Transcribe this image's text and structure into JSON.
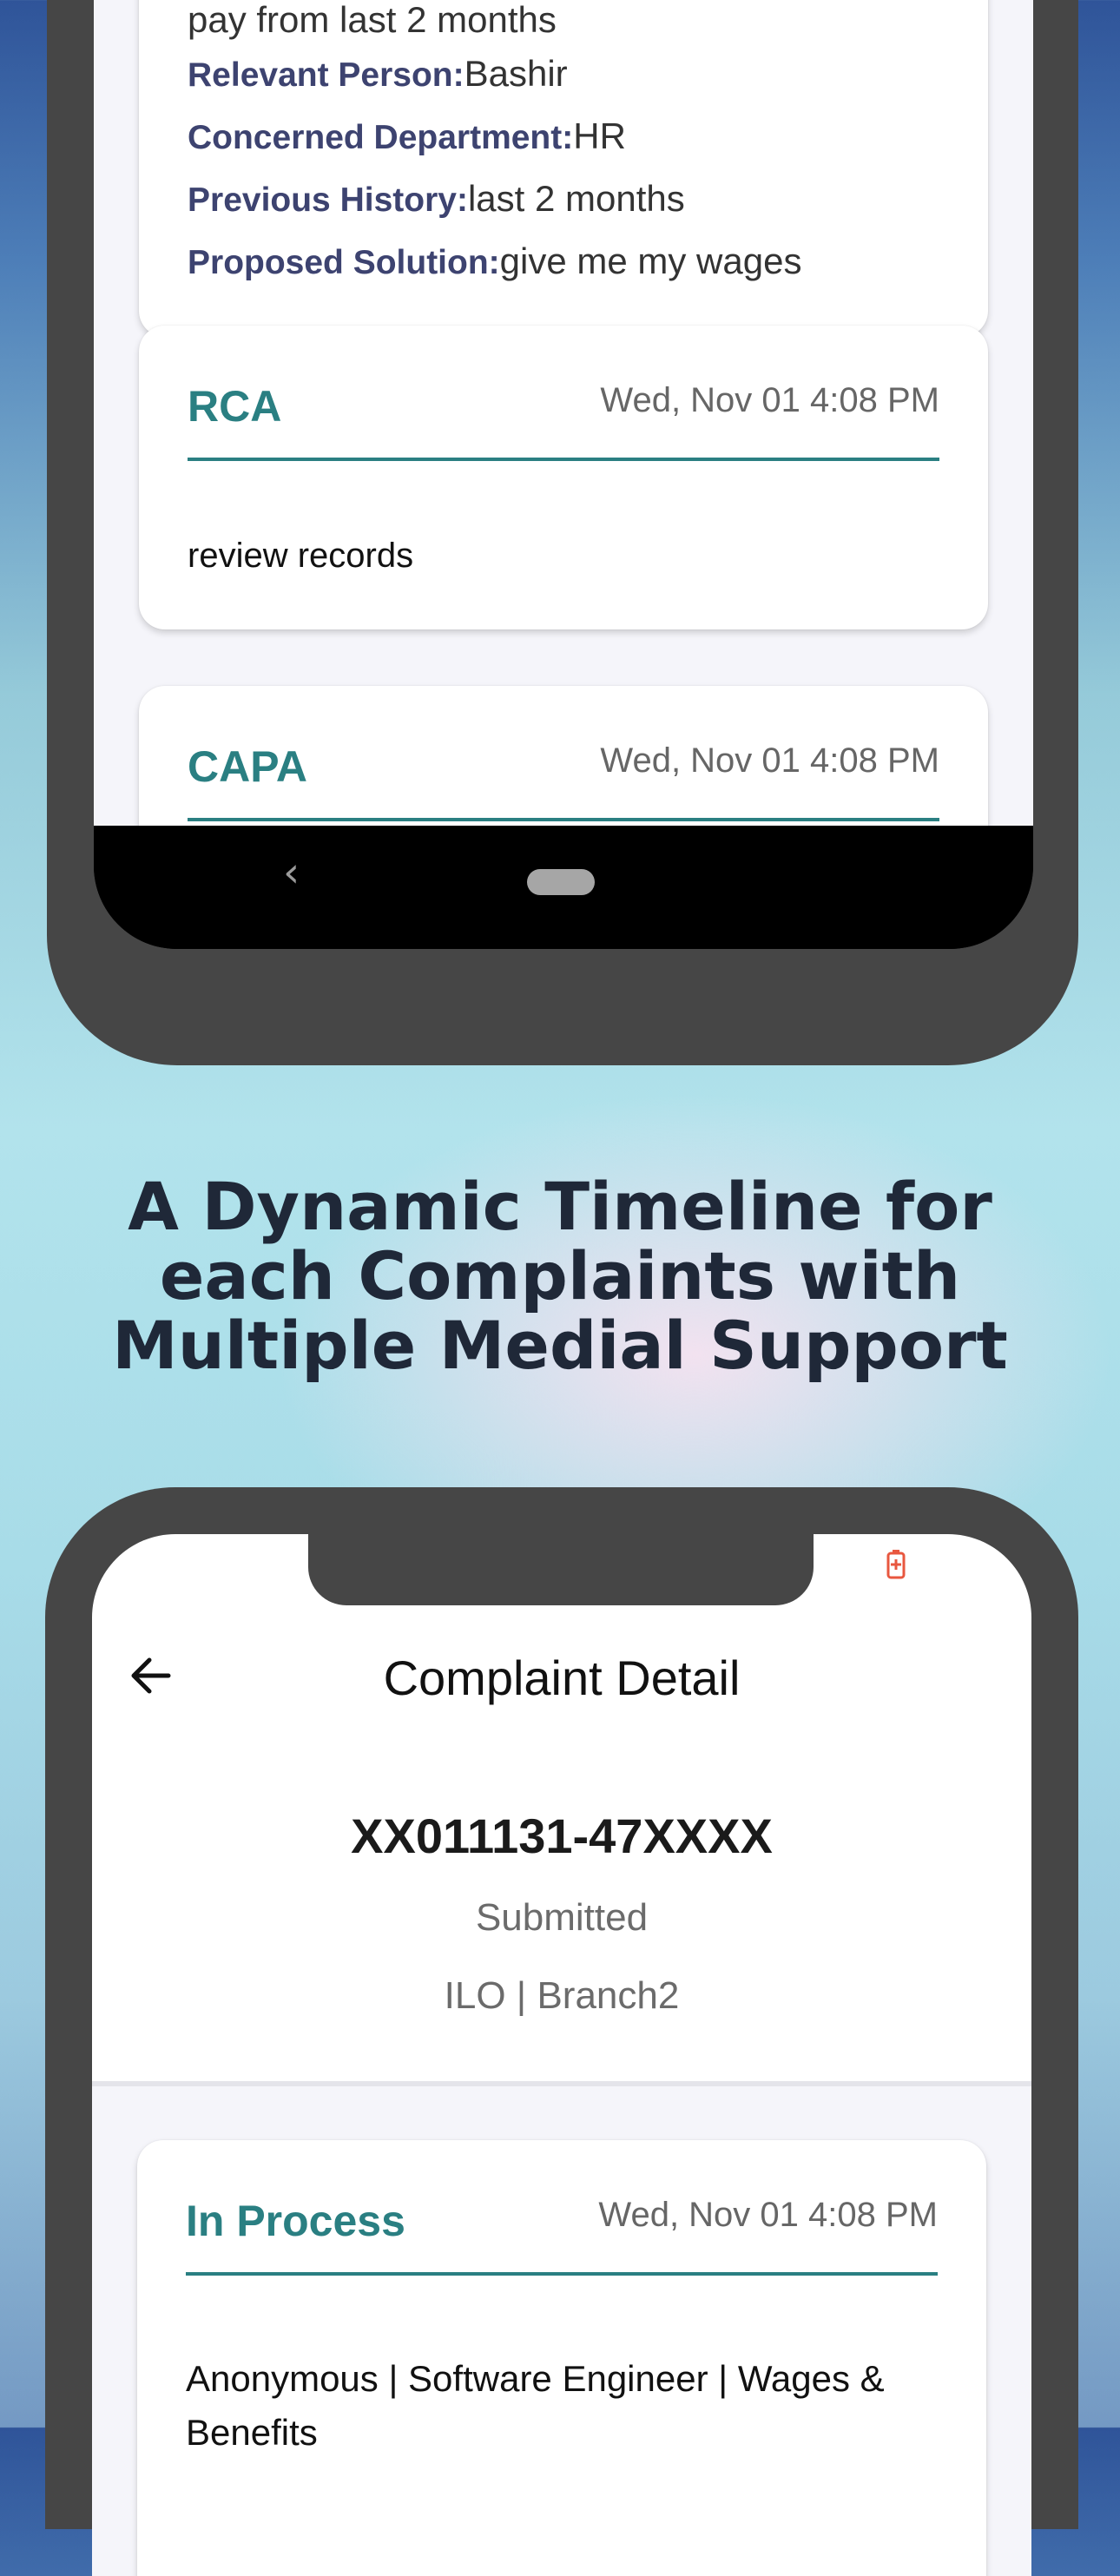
{
  "top_screen": {
    "details_card": {
      "partial_line": "pay from last 2 months",
      "fields": [
        {
          "key": "Relevant Person:",
          "value": "Bashir"
        },
        {
          "key": "Concerned Department:",
          "value": "HR"
        },
        {
          "key": "Previous History:",
          "value": "last 2 months"
        },
        {
          "key": "Proposed Solution:",
          "value": "give me my wages"
        }
      ]
    },
    "rca_card": {
      "title": "RCA",
      "timestamp": "Wed, Nov 01 4:08 PM",
      "body": "review records"
    },
    "capa_card": {
      "title": "CAPA",
      "timestamp": "Wed, Nov 01 4:08 PM"
    },
    "navbar": {
      "back_glyph": "‹"
    }
  },
  "headline": {
    "line1": "A Dynamic Timeline for",
    "line2": "each Complaints with",
    "line3": "Multiple Medial Support"
  },
  "bottom_screen": {
    "title": "Complaint Detail",
    "ticket_id": "XX011131-47XXXX",
    "status": "Submitted",
    "organization": "ILO | Branch2",
    "timeline_card": {
      "title": "In Process",
      "timestamp": "Wed, Nov 01 4:08 PM",
      "body": "Anonymous | Software Engineer | Wages & Benefits"
    },
    "icons": {
      "battery": "battery-low-icon",
      "back": "back-arrow-icon"
    },
    "battery_color": "#e8573f"
  },
  "colors": {
    "accent": "#2a7f82",
    "field_key": "#3d4370",
    "headline": "#1f2838"
  }
}
